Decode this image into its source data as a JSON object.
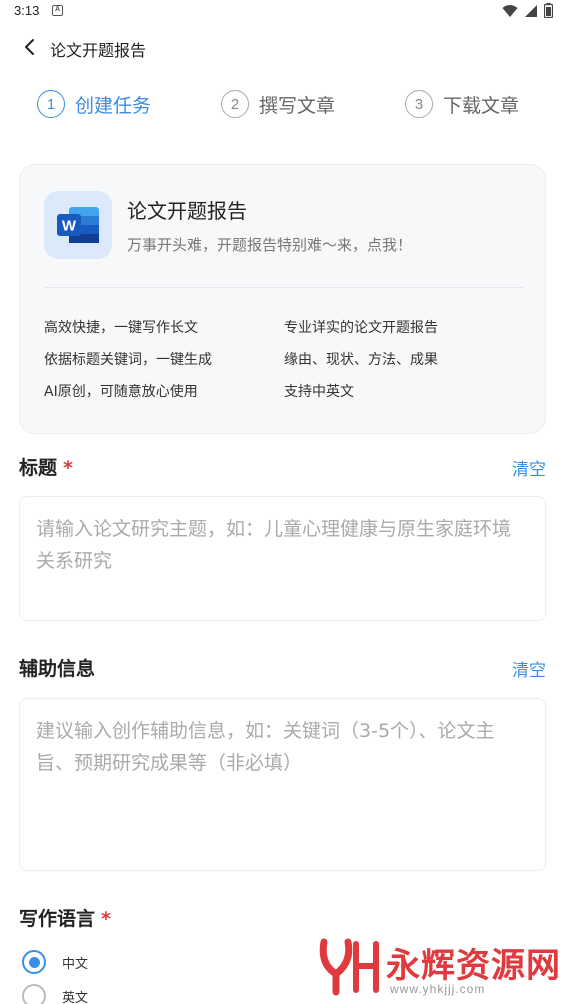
{
  "status_bar": {
    "time": "3:13",
    "notification_icon": "A"
  },
  "header": {
    "title": "论文开题报告",
    "back_icon": "chevron-left-icon"
  },
  "steps": [
    {
      "number": "1",
      "label": "创建任务",
      "active": true
    },
    {
      "number": "2",
      "label": "撰写文章",
      "active": false
    },
    {
      "number": "3",
      "label": "下载文章",
      "active": false
    }
  ],
  "intro_card": {
    "logo_letter": "W",
    "title": "论文开题报告",
    "subtitle": "万事开头难，开题报告特别难～来，点我！",
    "features": [
      "高效快捷，一键写作长文",
      "专业详实的论文开题报告",
      "依据标题关键词，一键生成",
      "缘由、现状、方法、成果",
      "AI原创，可随意放心使用",
      "支持中英文"
    ]
  },
  "title_section": {
    "label": "标题",
    "required_mark": "*",
    "clear_label": "清空",
    "placeholder": "请输入论文研究主题，如：儿童心理健康与原生家庭环境关系研究"
  },
  "aux_section": {
    "label": "辅助信息",
    "clear_label": "清空",
    "placeholder": "建议输入创作辅助信息，如：关键词（3-5个）、论文主旨、预期研究成果等（非必填）"
  },
  "language_section": {
    "label": "写作语言",
    "required_mark": "*",
    "options": [
      {
        "label": "中文",
        "selected": true
      },
      {
        "label": "英文",
        "selected": false
      }
    ]
  },
  "watermark": {
    "brand": "永辉资源网",
    "url": "www.yhkjjj.com"
  },
  "colors": {
    "accent": "#3a8ee6",
    "required": "#e0393e",
    "word_blue": "#185abd"
  }
}
